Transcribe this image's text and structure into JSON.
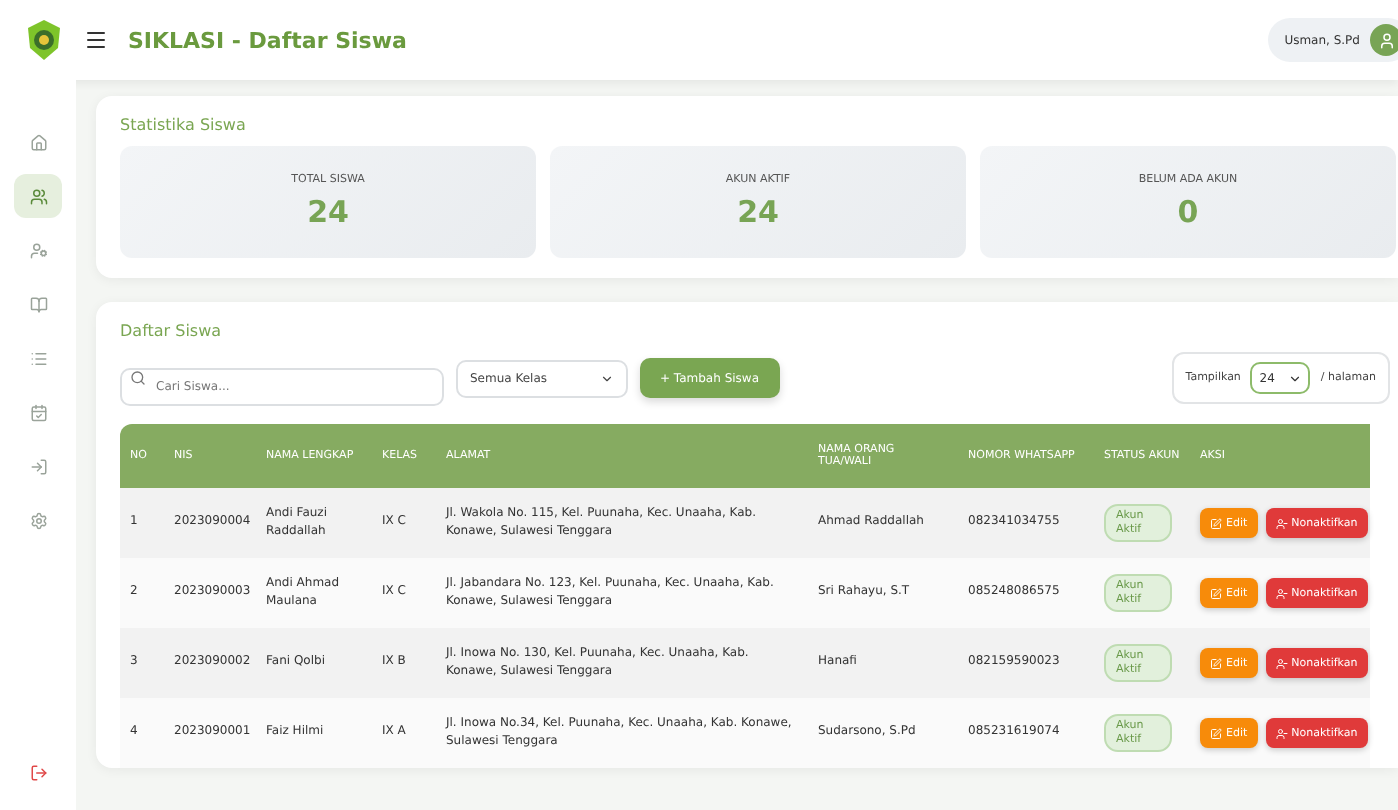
{
  "header": {
    "title": "SIKLASI - Daftar Siswa",
    "user": "Usman, S.Pd"
  },
  "sidebar": {
    "items": [
      {
        "kind": "home",
        "selected": false
      },
      {
        "kind": "students",
        "selected": true
      },
      {
        "kind": "teachers",
        "selected": false
      },
      {
        "kind": "book",
        "selected": false
      },
      {
        "kind": "list",
        "selected": false
      },
      {
        "kind": "calendar",
        "selected": false
      },
      {
        "kind": "login",
        "selected": false
      },
      {
        "kind": "settings",
        "selected": false
      }
    ],
    "logout": {
      "kind": "logout"
    }
  },
  "stats": {
    "title": "Statistika Siswa",
    "cards": [
      {
        "label": "TOTAL SISWA",
        "value": "24"
      },
      {
        "label": "AKUN AKTIF",
        "value": "24"
      },
      {
        "label": "BELUM ADA AKUN",
        "value": "0"
      }
    ]
  },
  "list": {
    "title": "Daftar Siswa",
    "search": {
      "placeholder": "Cari Siswa..."
    },
    "class_filter": "Semua Kelas",
    "add_button": "+ Tambah Siswa",
    "page_size": {
      "before": "Tampilkan",
      "value": "24",
      "after": "/ halaman"
    },
    "table": {
      "columns": [
        "NO",
        "NIS",
        "NAMA LENGKAP",
        "KELAS",
        "ALAMAT",
        "NAMA ORANG TUA/WALI",
        "NOMOR WHATSAPP",
        "STATUS AKUN",
        "AKSI"
      ],
      "rows": [
        {
          "cells": [
            "1",
            "2023090004",
            "Andi Fauzi Raddallah",
            "IX C",
            "Jl. Wakola No. 115, Kel. Puunaha, Kec. Unaaha, Kab. Konawe, Sulawesi Tenggara",
            "Ahmad Raddallah",
            "082341034755"
          ],
          "status": "Akun Aktif",
          "actions": [
            "Edit",
            "Nonaktifkan"
          ]
        },
        {
          "cells": [
            "2",
            "2023090003",
            "Andi Ahmad Maulana",
            "IX C",
            "Jl. Jabandara No. 123, Kel. Puunaha, Kec. Unaaha, Kab. Konawe, Sulawesi Tenggara",
            "Sri Rahayu, S.T",
            "085248086575"
          ],
          "status": "Akun Aktif",
          "actions": [
            "Edit",
            "Nonaktifkan"
          ]
        },
        {
          "cells": [
            "3",
            "2023090002",
            "Fani Qolbi",
            "IX B",
            "Jl. Inowa No. 130, Kel. Puunaha, Kec. Unaaha, Kab. Konawe, Sulawesi Tenggara",
            "Hanafi",
            "082159590023"
          ],
          "status": "Akun Aktif",
          "actions": [
            "Edit",
            "Nonaktifkan"
          ]
        },
        {
          "cells": [
            "4",
            "2023090001",
            "Faiz Hilmi",
            "IX A",
            "Jl. Inowa No.34, Kel. Puunaha, Kec. Unaaha, Kab. Konawe, Sulawesi Tenggara",
            "Sudarsono, S.Pd",
            "085231619074"
          ],
          "status": "Akun Aktif",
          "actions": [
            "Edit",
            "Nonaktifkan"
          ]
        }
      ]
    }
  }
}
